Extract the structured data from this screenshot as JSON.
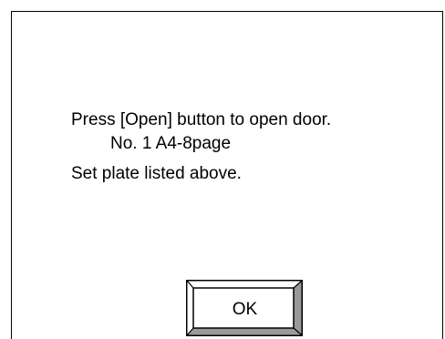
{
  "dialog": {
    "message_lines": [
      "Press [Open] button to open door.",
      "No. 1 A4-8page",
      "Set plate listed above."
    ],
    "ok_label": "OK"
  }
}
